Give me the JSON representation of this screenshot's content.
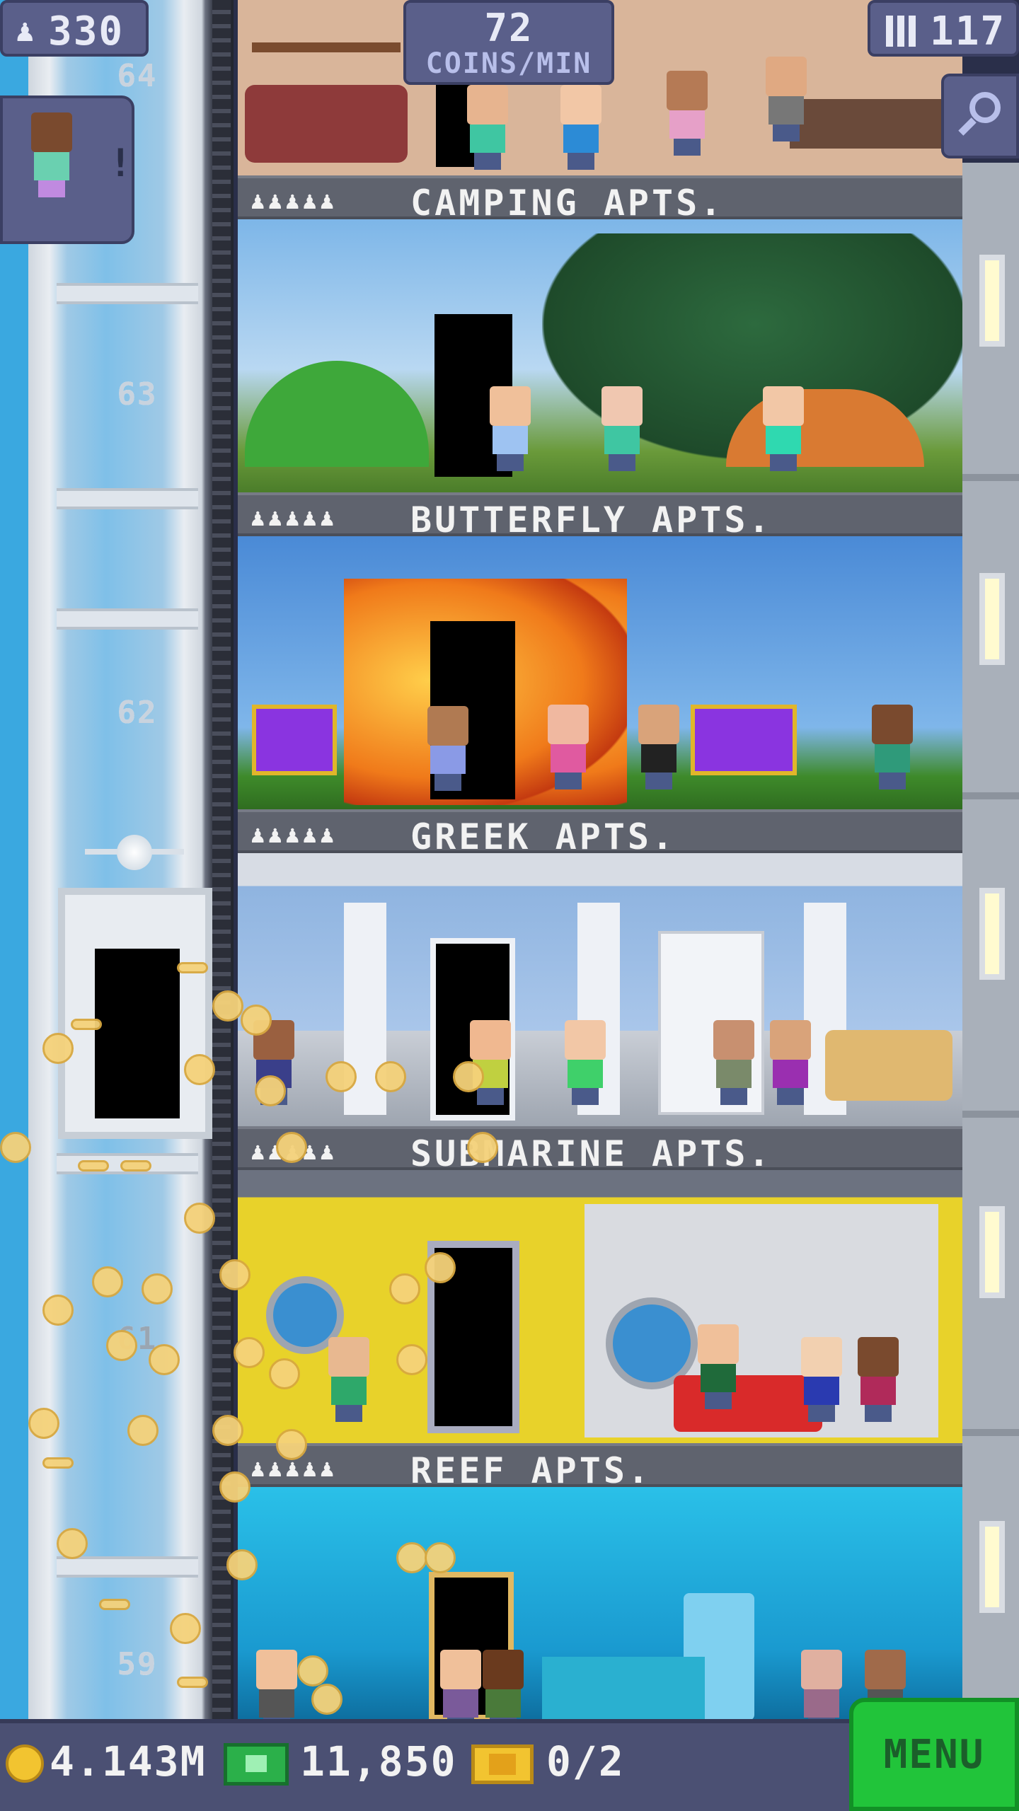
{
  "hud": {
    "population": "330",
    "coins_per_min_value": "72",
    "coins_per_min_label": "COINS/MIN",
    "floor_count": "117"
  },
  "shaft": {
    "floor_numbers": [
      "64",
      "63",
      "62",
      "61",
      "60",
      "59"
    ]
  },
  "floors": [
    {
      "name": "CAMPING APTS.",
      "occupancy": "♟♟♟♟♟"
    },
    {
      "name": "BUTTERFLY APTS.",
      "occupancy": "♟♟♟♟♟"
    },
    {
      "name": "GREEK APTS.",
      "occupancy": "♟♟♟♟♟"
    },
    {
      "name": "SUBMARINE APTS.",
      "occupancy": "♟♟♟♟♟"
    },
    {
      "name": "REEF APTS.",
      "occupancy": "♟♟♟♟♟"
    }
  ],
  "bottom_bar": {
    "coins": "4.143M",
    "bux": "11,850",
    "tickets": "0/2",
    "menu_label": "MENU"
  },
  "icons": {
    "population": "person-icon",
    "floors": "building-icon",
    "search": "magnifier-icon",
    "coins": "coin-icon",
    "bux": "bux-icon",
    "tickets": "ticket-icon"
  },
  "colors": {
    "hud_chip": "#5a5f8a",
    "menu_green": "#21c43a",
    "coin_gold": "#f2c430",
    "label_bar": "#5f636e",
    "sky_blue": "#3aa8e0"
  }
}
